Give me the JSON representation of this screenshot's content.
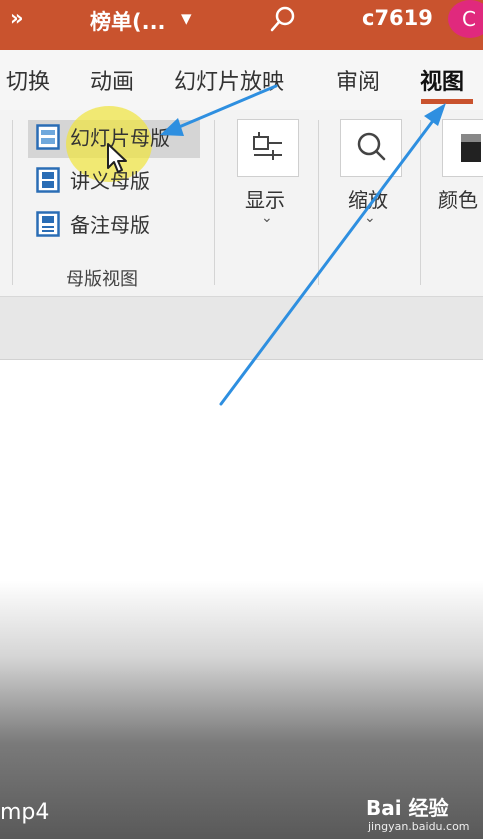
{
  "titlebar": {
    "overflow": "»",
    "doc_title": "榜单(...",
    "dropdown": "▾",
    "user": "c7619",
    "avatar": "C"
  },
  "tabs": [
    {
      "label": "切换"
    },
    {
      "label": "动画"
    },
    {
      "label": "幻灯片放映"
    },
    {
      "label": "审阅"
    },
    {
      "label": "视图",
      "active": true
    }
  ],
  "ribbon": {
    "master_views": {
      "items": [
        {
          "label": "幻灯片母版",
          "selected": true
        },
        {
          "label": "讲义母版"
        },
        {
          "label": "备注母版"
        }
      ],
      "group_label": "母版视图"
    },
    "show": {
      "label": "显示",
      "chevron": "⌄"
    },
    "zoom": {
      "label": "缩放",
      "chevron": "⌄"
    },
    "color": {
      "label": "颜色"
    }
  },
  "video": {
    "filename_tail": "mp4"
  },
  "watermark": {
    "main": "Bai 经验",
    "sub": "jingyan.baidu.com"
  },
  "colors": {
    "accent": "#c9532e",
    "avatar": "#e0297d",
    "arrow": "#2e8fe0"
  }
}
